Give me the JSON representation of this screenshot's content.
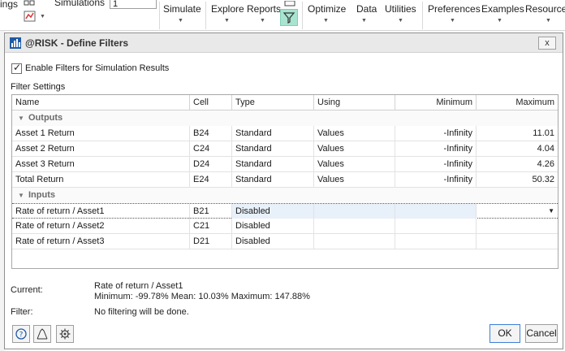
{
  "ribbon": {
    "partial_label": "ings",
    "simulations_label": "Simulations",
    "simulations_value": "1",
    "simulate": "Simulate",
    "explore": "Explore",
    "reports": "Reports",
    "optimize": "Optimize",
    "data": "Data",
    "utilities": "Utilities",
    "preferences": "Preferences",
    "examples": "Examples",
    "resources": "Resources"
  },
  "dialog": {
    "title": "@RISK - Define Filters",
    "close_label": "x",
    "enable_label": "Enable Filters for Simulation Results",
    "enable_checked": true,
    "settings_label": "Filter Settings",
    "columns": [
      "Name",
      "Cell",
      "Type",
      "Using",
      "Minimum",
      "Maximum"
    ],
    "groups": {
      "outputs": "Outputs",
      "inputs": "Inputs"
    },
    "outputs": [
      {
        "name": "Asset 1 Return",
        "cell": "B24",
        "type": "Standard",
        "using": "Values",
        "min": "-Infinity",
        "max": "11.01"
      },
      {
        "name": "Asset 2 Return",
        "cell": "C24",
        "type": "Standard",
        "using": "Values",
        "min": "-Infinity",
        "max": "4.04"
      },
      {
        "name": "Asset 3 Return",
        "cell": "D24",
        "type": "Standard",
        "using": "Values",
        "min": "-Infinity",
        "max": "4.26"
      },
      {
        "name": "Total Return",
        "cell": "E24",
        "type": "Standard",
        "using": "Values",
        "min": "-Infinity",
        "max": "50.32"
      }
    ],
    "inputs": [
      {
        "name": "Rate of return / Asset1",
        "cell": "B21",
        "type": "Disabled",
        "using": "",
        "min": "",
        "max": ""
      },
      {
        "name": "Rate of return / Asset2",
        "cell": "C21",
        "type": "Disabled",
        "using": "",
        "min": "",
        "max": ""
      },
      {
        "name": "Rate of return / Asset3",
        "cell": "D21",
        "type": "Disabled",
        "using": "",
        "min": "",
        "max": ""
      }
    ],
    "current_label": "Current:",
    "current_name": "Rate of return / Asset1",
    "current_stats": "Minimum: -99.78%  Mean: 10.03%  Maximum: 147.88%",
    "filter_label": "Filter:",
    "filter_text": "No filtering will be done.",
    "ok_label": "OK",
    "cancel_label": "Cancel"
  },
  "icons": {
    "help": "help-icon",
    "distribution": "distribution-icon",
    "settings": "settings-icon",
    "filter": "filter-icon",
    "app": "risk-app-icon"
  },
  "colors": {
    "filter_button": "#a8e4cf",
    "selected_cell": "#e8f0fa",
    "ok_border": "#3c7fd6"
  }
}
